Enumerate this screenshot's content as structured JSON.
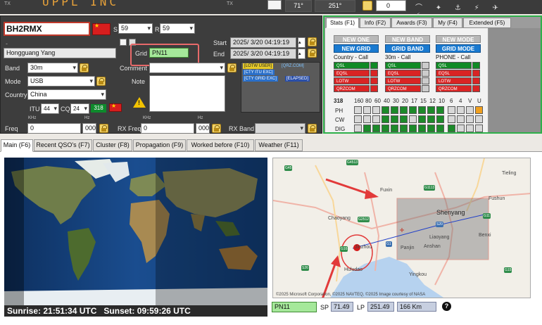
{
  "topbar": {
    "tx_left": "TX",
    "tx_right": "TX",
    "azimuth_sp": "71°",
    "azimuth_lp": "251°",
    "rotator_value": "0"
  },
  "qso": {
    "callsign": "BH2RMX",
    "rst_sent_label": "S",
    "rst_sent": "59",
    "rst_rcvd_label": "R",
    "rst_rcvd": "59",
    "name": "Hongguang Yang",
    "grid_label": "Grid",
    "grid": "PN11",
    "start_label": "Start",
    "start": "2025/ 3/20 04:19:19",
    "end_label": "End",
    "end": "2025/ 3/20 04:19:19",
    "band_label": "Band",
    "band": "30m",
    "mode_label": "Mode",
    "mode": "USB",
    "country_label": "Country",
    "country": "China",
    "comment_label": "Comment",
    "note_label": "Note",
    "itu_label": "ITU",
    "itu": "44",
    "cq_label": "CQ",
    "cq": "24",
    "dxcc_count": "318",
    "tags": {
      "lotw_user": "[LOTW USER]",
      "qrz": "[QRZ.COM]",
      "cty_itu": "[CTY ITU EXC]",
      "cty_grid": "[CTY GRID EXC]",
      "elapsed": "[ELAPSED]"
    },
    "freq_label": "Freq",
    "rx_freq_label": "RX Freq",
    "rx_band_label": "RX Band",
    "khz_label": "KHz",
    "hz_label": "Hz",
    "freq_khz": "0",
    "freq_hz": "000",
    "rx_freq_khz": "0",
    "rx_freq_hz": "000"
  },
  "stats": {
    "tabs": [
      "Stats (F1)",
      "Info (F2)",
      "Awards (F3)",
      "My (F4)",
      "Extended (F5)"
    ],
    "new_one": "NEW ONE",
    "new_grid": "NEW GRID",
    "new_band": "NEW BAND",
    "grid_band": "GRID BAND",
    "new_mode": "NEW MODE",
    "grid_mode": "GRID MODE",
    "col1_title": "Country - Call",
    "col2_title": "30m - Call",
    "col3_title": "PHONE - Call",
    "qsl": "QSL",
    "eqsl": "EQSL",
    "lotw": "LOTW",
    "qrzcom": "QRZCOM",
    "total": "318",
    "bands": [
      "160",
      "80",
      "60",
      "40",
      "30",
      "20",
      "17",
      "15",
      "12",
      "10",
      "6",
      "4",
      "V",
      "U"
    ],
    "rows": [
      "PH",
      "CW",
      "DIG"
    ]
  },
  "tabs": [
    "Main (F6)",
    "Recent QSO's (F7)",
    "Cluster (F8)",
    "Propagation (F9)",
    "Worked before (F10)",
    "Weather (F11)"
  ],
  "world": {
    "sunrise_label": "Sunrise:",
    "sunrise": "21:51:34 UTC",
    "sunset_label": "Sunset:",
    "sunset": "09:59:26 UTC"
  },
  "local_map": {
    "cities": {
      "tieling": "Tieling",
      "fuxin": "Fuxin",
      "fushun": "Fushun",
      "shenyang": "Shenyang",
      "chaoyang": "Chaoyang",
      "benxi": "Benxi",
      "liaoyang": "Liaoyang",
      "anshan": "Anshan",
      "panjin": "Panjin",
      "jinzhou": "Jinzhou",
      "huludao": "Huludao",
      "yingkou": "Yingkou"
    },
    "copyright": "©2025 Microsoft Corporation, ©2025 NAVTEQ, ©2025 Image courtesy of NASA"
  },
  "bottom": {
    "grid": "PN11",
    "sp_label": "SP",
    "sp": "71.49",
    "lp_label": "LP",
    "lp": "251.49",
    "distance": "166 Km"
  }
}
